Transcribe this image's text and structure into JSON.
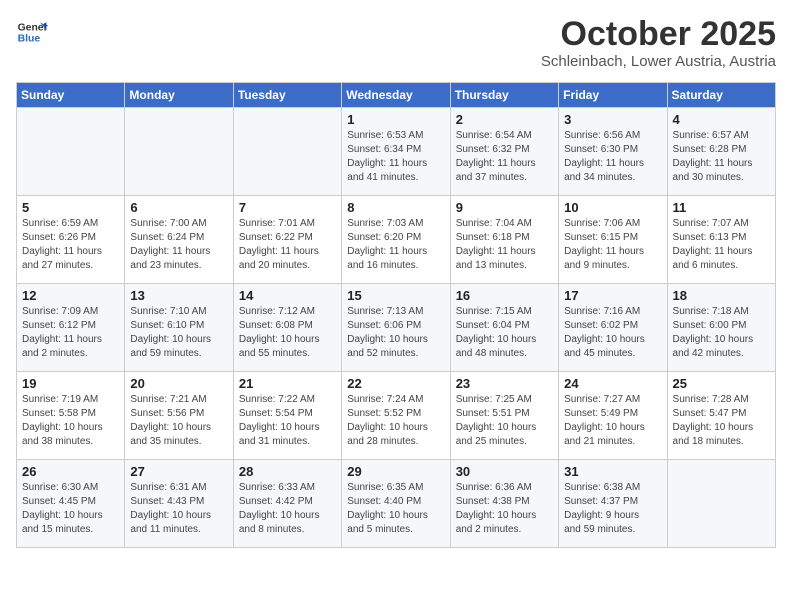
{
  "header": {
    "logo_line1": "General",
    "logo_line2": "Blue",
    "month_title": "October 2025",
    "location": "Schleinbach, Lower Austria, Austria"
  },
  "weekdays": [
    "Sunday",
    "Monday",
    "Tuesday",
    "Wednesday",
    "Thursday",
    "Friday",
    "Saturday"
  ],
  "weeks": [
    [
      {
        "day": "",
        "text": ""
      },
      {
        "day": "",
        "text": ""
      },
      {
        "day": "",
        "text": ""
      },
      {
        "day": "1",
        "text": "Sunrise: 6:53 AM\nSunset: 6:34 PM\nDaylight: 11 hours\nand 41 minutes."
      },
      {
        "day": "2",
        "text": "Sunrise: 6:54 AM\nSunset: 6:32 PM\nDaylight: 11 hours\nand 37 minutes."
      },
      {
        "day": "3",
        "text": "Sunrise: 6:56 AM\nSunset: 6:30 PM\nDaylight: 11 hours\nand 34 minutes."
      },
      {
        "day": "4",
        "text": "Sunrise: 6:57 AM\nSunset: 6:28 PM\nDaylight: 11 hours\nand 30 minutes."
      }
    ],
    [
      {
        "day": "5",
        "text": "Sunrise: 6:59 AM\nSunset: 6:26 PM\nDaylight: 11 hours\nand 27 minutes."
      },
      {
        "day": "6",
        "text": "Sunrise: 7:00 AM\nSunset: 6:24 PM\nDaylight: 11 hours\nand 23 minutes."
      },
      {
        "day": "7",
        "text": "Sunrise: 7:01 AM\nSunset: 6:22 PM\nDaylight: 11 hours\nand 20 minutes."
      },
      {
        "day": "8",
        "text": "Sunrise: 7:03 AM\nSunset: 6:20 PM\nDaylight: 11 hours\nand 16 minutes."
      },
      {
        "day": "9",
        "text": "Sunrise: 7:04 AM\nSunset: 6:18 PM\nDaylight: 11 hours\nand 13 minutes."
      },
      {
        "day": "10",
        "text": "Sunrise: 7:06 AM\nSunset: 6:15 PM\nDaylight: 11 hours\nand 9 minutes."
      },
      {
        "day": "11",
        "text": "Sunrise: 7:07 AM\nSunset: 6:13 PM\nDaylight: 11 hours\nand 6 minutes."
      }
    ],
    [
      {
        "day": "12",
        "text": "Sunrise: 7:09 AM\nSunset: 6:12 PM\nDaylight: 11 hours\nand 2 minutes."
      },
      {
        "day": "13",
        "text": "Sunrise: 7:10 AM\nSunset: 6:10 PM\nDaylight: 10 hours\nand 59 minutes."
      },
      {
        "day": "14",
        "text": "Sunrise: 7:12 AM\nSunset: 6:08 PM\nDaylight: 10 hours\nand 55 minutes."
      },
      {
        "day": "15",
        "text": "Sunrise: 7:13 AM\nSunset: 6:06 PM\nDaylight: 10 hours\nand 52 minutes."
      },
      {
        "day": "16",
        "text": "Sunrise: 7:15 AM\nSunset: 6:04 PM\nDaylight: 10 hours\nand 48 minutes."
      },
      {
        "day": "17",
        "text": "Sunrise: 7:16 AM\nSunset: 6:02 PM\nDaylight: 10 hours\nand 45 minutes."
      },
      {
        "day": "18",
        "text": "Sunrise: 7:18 AM\nSunset: 6:00 PM\nDaylight: 10 hours\nand 42 minutes."
      }
    ],
    [
      {
        "day": "19",
        "text": "Sunrise: 7:19 AM\nSunset: 5:58 PM\nDaylight: 10 hours\nand 38 minutes."
      },
      {
        "day": "20",
        "text": "Sunrise: 7:21 AM\nSunset: 5:56 PM\nDaylight: 10 hours\nand 35 minutes."
      },
      {
        "day": "21",
        "text": "Sunrise: 7:22 AM\nSunset: 5:54 PM\nDaylight: 10 hours\nand 31 minutes."
      },
      {
        "day": "22",
        "text": "Sunrise: 7:24 AM\nSunset: 5:52 PM\nDaylight: 10 hours\nand 28 minutes."
      },
      {
        "day": "23",
        "text": "Sunrise: 7:25 AM\nSunset: 5:51 PM\nDaylight: 10 hours\nand 25 minutes."
      },
      {
        "day": "24",
        "text": "Sunrise: 7:27 AM\nSunset: 5:49 PM\nDaylight: 10 hours\nand 21 minutes."
      },
      {
        "day": "25",
        "text": "Sunrise: 7:28 AM\nSunset: 5:47 PM\nDaylight: 10 hours\nand 18 minutes."
      }
    ],
    [
      {
        "day": "26",
        "text": "Sunrise: 6:30 AM\nSunset: 4:45 PM\nDaylight: 10 hours\nand 15 minutes."
      },
      {
        "day": "27",
        "text": "Sunrise: 6:31 AM\nSunset: 4:43 PM\nDaylight: 10 hours\nand 11 minutes."
      },
      {
        "day": "28",
        "text": "Sunrise: 6:33 AM\nSunset: 4:42 PM\nDaylight: 10 hours\nand 8 minutes."
      },
      {
        "day": "29",
        "text": "Sunrise: 6:35 AM\nSunset: 4:40 PM\nDaylight: 10 hours\nand 5 minutes."
      },
      {
        "day": "30",
        "text": "Sunrise: 6:36 AM\nSunset: 4:38 PM\nDaylight: 10 hours\nand 2 minutes."
      },
      {
        "day": "31",
        "text": "Sunrise: 6:38 AM\nSunset: 4:37 PM\nDaylight: 9 hours\nand 59 minutes."
      },
      {
        "day": "",
        "text": ""
      }
    ]
  ]
}
